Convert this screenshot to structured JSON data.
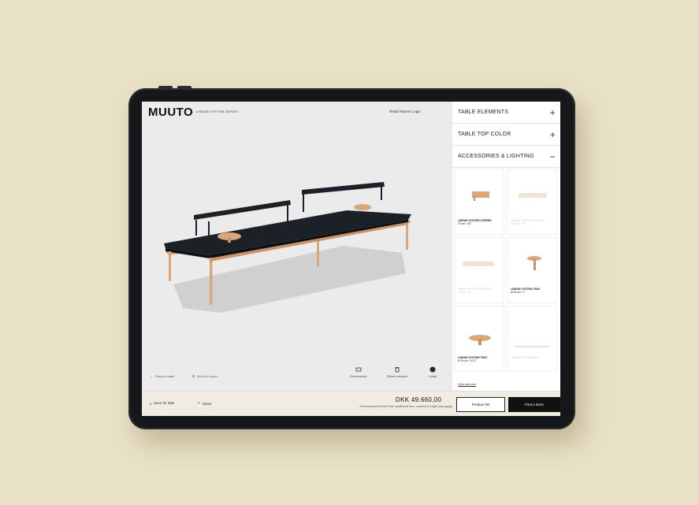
{
  "header": {
    "logo": "MUUTO",
    "series": "← LINEAR SYSTEM SERIES",
    "login": "Retail Partner Login"
  },
  "viewer_hints": [
    {
      "icon": "drag-icon",
      "label": "Drag to rotate"
    },
    {
      "icon": "scroll-icon",
      "label": "Scroll to zoom"
    }
  ],
  "viewer_tools": [
    {
      "icon": "dimensions-icon",
      "label": "Dimensions"
    },
    {
      "icon": "trash-icon",
      "label": "Reset onboard"
    },
    {
      "icon": "guide-icon",
      "label": "Guide"
    }
  ],
  "panel": {
    "sections": [
      {
        "label": "TABLE ELEMENTS",
        "state": "+"
      },
      {
        "label": "TABLE TOP COLOR",
        "state": "+"
      },
      {
        "label": "ACCESSORIES & LIGHTING",
        "state": "−"
      }
    ],
    "products": [
      {
        "name": "LINEAR SYSTEM SCREEN",
        "sub": "75 cm / 30\"",
        "active": true
      },
      {
        "name": "LINEAR SYSTEM SCREEN",
        "sub": "150 cm / 59\"",
        "active": false
      },
      {
        "name": "LINEAR SYSTEM SCREEN",
        "sub": "75 cm / 30\"",
        "active": false
      },
      {
        "name": "LINEAR SYSTEM TRAY",
        "sub": "Ø 18 cm / 7\"",
        "active": true
      },
      {
        "name": "LINEAR SYSTEM TRAY",
        "sub": "Ø 26 cm / 10.2\"",
        "active": true
      },
      {
        "name": "LINEAR SYSTEM RAIL",
        "sub": "",
        "active": false
      }
    ],
    "view_all": "View add-ons"
  },
  "bottom": {
    "save_label": "Save for later",
    "share_label": "Share",
    "price": "DKK 49.660,00",
    "price_note": "Recommended Retail Price (additional fees, customs & freight may apply)",
    "product_list": "Product list",
    "find_store": "Find a store"
  },
  "colors": {
    "background": "#e9e1c6",
    "tabletop": "#1b2126",
    "wood": "#d9a77a",
    "accent_dark": "#111111"
  }
}
